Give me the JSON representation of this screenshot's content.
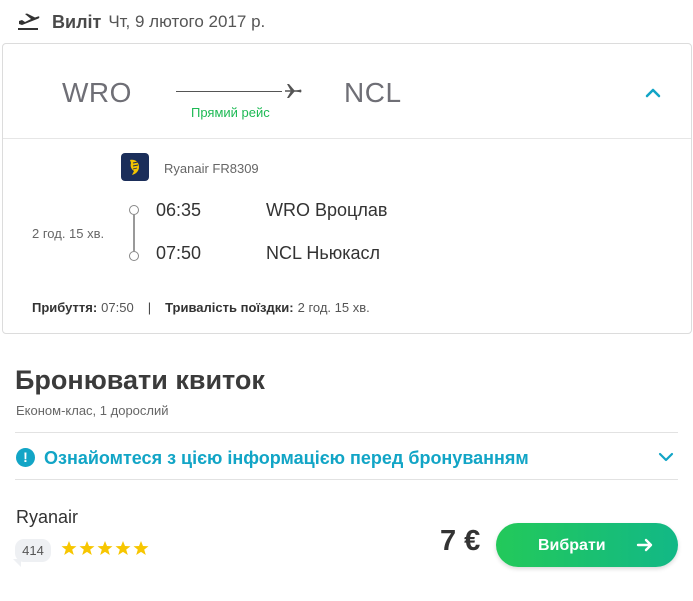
{
  "header": {
    "title": "Виліт",
    "date": "Чт, 9 лютого 2017 р.",
    "icon": "plane-departure-icon"
  },
  "route": {
    "from": "WRO",
    "to": "NCL",
    "flight_type": "Прямий рейс"
  },
  "segment": {
    "airline_flight": "Ryanair FR8309",
    "duration": "2 год. 15 хв.",
    "departure": {
      "time": "06:35",
      "place": "WRO Вроцлав"
    },
    "arrival": {
      "time": "07:50",
      "place": "NCL Ньюкасл"
    },
    "summary": {
      "arrival_label": "Прибуття:",
      "arrival_value": "07:50",
      "separator": "|",
      "trip_label": "Тривалість поїздки:",
      "trip_value": "2 год. 15 хв."
    }
  },
  "booking": {
    "title": "Бронювати квиток",
    "subtitle": "Економ-клас, 1 дорослий",
    "info_text": "Ознайомтеся з цією інформацією перед бронуванням"
  },
  "offer": {
    "airline": "Ryanair",
    "reviews": "414",
    "rating_stars": 5,
    "price": "7 €",
    "button_label": "Вибрати"
  },
  "colors": {
    "accent_green": "#1db954",
    "accent_teal": "#12a5c6",
    "star": "#f7c600",
    "button_gradient_start": "#23c95a",
    "button_gradient_end": "#12b886",
    "ryanair_navy": "#1b2e5a"
  }
}
